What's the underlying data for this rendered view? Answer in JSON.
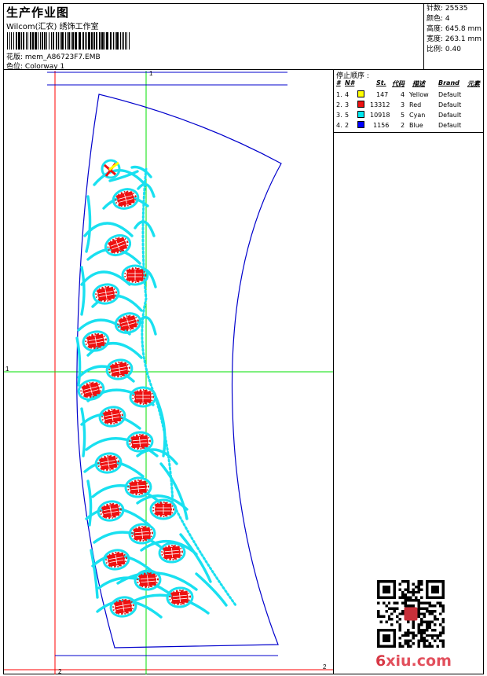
{
  "header": {
    "title": "生产作业图",
    "company": "Wilcom(汇农) 绣饰工作室",
    "file_label": "花版: ",
    "file_name": "mem_A86723F7.EMB",
    "colorway_label": "色位: ",
    "colorway_name": "Colorway 1"
  },
  "stats": {
    "stitches": "针数: 25535",
    "colors": "颜色: 4",
    "height": "高度: 645.8 mm",
    "width": "宽度: 263.1 mm",
    "scale": "比例: 0.40"
  },
  "stop_sequence": {
    "title": "停止顺序 :",
    "headers": [
      "#",
      "N#",
      "St.",
      "代码",
      "描述",
      "Brand",
      "元素"
    ],
    "rows": [
      {
        "seq": "1.",
        "needle": "4",
        "color": "#ffff00",
        "stitches": "147",
        "code": "4",
        "desc": "Yellow",
        "brand": "Default"
      },
      {
        "seq": "2.",
        "needle": "3",
        "color": "#ee1111",
        "stitches": "13312",
        "code": "3",
        "desc": "Red",
        "brand": "Default"
      },
      {
        "seq": "3.",
        "needle": "5",
        "color": "#00e8f0",
        "stitches": "10918",
        "code": "5",
        "desc": "Cyan",
        "brand": "Default"
      },
      {
        "seq": "4.",
        "needle": "2",
        "color": "#0000ff",
        "stitches": "1156",
        "code": "2",
        "desc": "Blue",
        "brand": "Default"
      }
    ]
  },
  "guide_labels": {
    "top": "1",
    "left": "1",
    "right": "2",
    "bottom": "2"
  },
  "watermark": {
    "prefix": "6",
    "text": "xiu.com"
  },
  "colors": {
    "red_guide": "#ff0000",
    "green_guide": "#00e000",
    "outline_blue": "#0000cc",
    "cyan": "#19e0f0",
    "red_fill": "#ee1111"
  }
}
